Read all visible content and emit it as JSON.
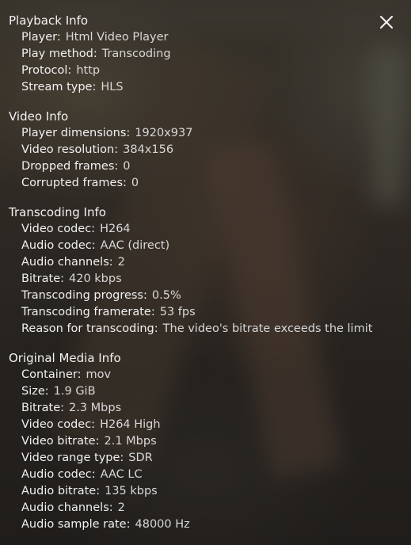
{
  "close_icon": "close-icon",
  "sections": [
    {
      "title": "Playback Info",
      "rows": [
        {
          "label": "Player:",
          "value": "Html Video Player"
        },
        {
          "label": "Play method:",
          "value": "Transcoding"
        },
        {
          "label": "Protocol:",
          "value": "http"
        },
        {
          "label": "Stream type:",
          "value": "HLS"
        }
      ]
    },
    {
      "title": "Video Info",
      "rows": [
        {
          "label": "Player dimensions:",
          "value": "1920x937"
        },
        {
          "label": "Video resolution:",
          "value": "384x156"
        },
        {
          "label": "Dropped frames:",
          "value": "0"
        },
        {
          "label": "Corrupted frames:",
          "value": "0"
        }
      ]
    },
    {
      "title": "Transcoding Info",
      "rows": [
        {
          "label": "Video codec:",
          "value": "H264"
        },
        {
          "label": "Audio codec:",
          "value": "AAC (direct)"
        },
        {
          "label": "Audio channels:",
          "value": "2"
        },
        {
          "label": "Bitrate:",
          "value": "420 kbps"
        },
        {
          "label": "Transcoding progress:",
          "value": "0.5%"
        },
        {
          "label": "Transcoding framerate:",
          "value": "53 fps"
        },
        {
          "label": "Reason for transcoding:",
          "value": "The video's bitrate exceeds the limit"
        }
      ]
    },
    {
      "title": "Original Media Info",
      "rows": [
        {
          "label": "Container:",
          "value": "mov"
        },
        {
          "label": "Size:",
          "value": "1.9 GiB"
        },
        {
          "label": "Bitrate:",
          "value": "2.3 Mbps"
        },
        {
          "label": "Video codec:",
          "value": "H264 High"
        },
        {
          "label": "Video bitrate:",
          "value": "2.1 Mbps"
        },
        {
          "label": "Video range type:",
          "value": "SDR"
        },
        {
          "label": "Audio codec:",
          "value": "AAC LC"
        },
        {
          "label": "Audio bitrate:",
          "value": "135 kbps"
        },
        {
          "label": "Audio channels:",
          "value": "2"
        },
        {
          "label": "Audio sample rate:",
          "value": "48000 Hz"
        }
      ]
    }
  ]
}
